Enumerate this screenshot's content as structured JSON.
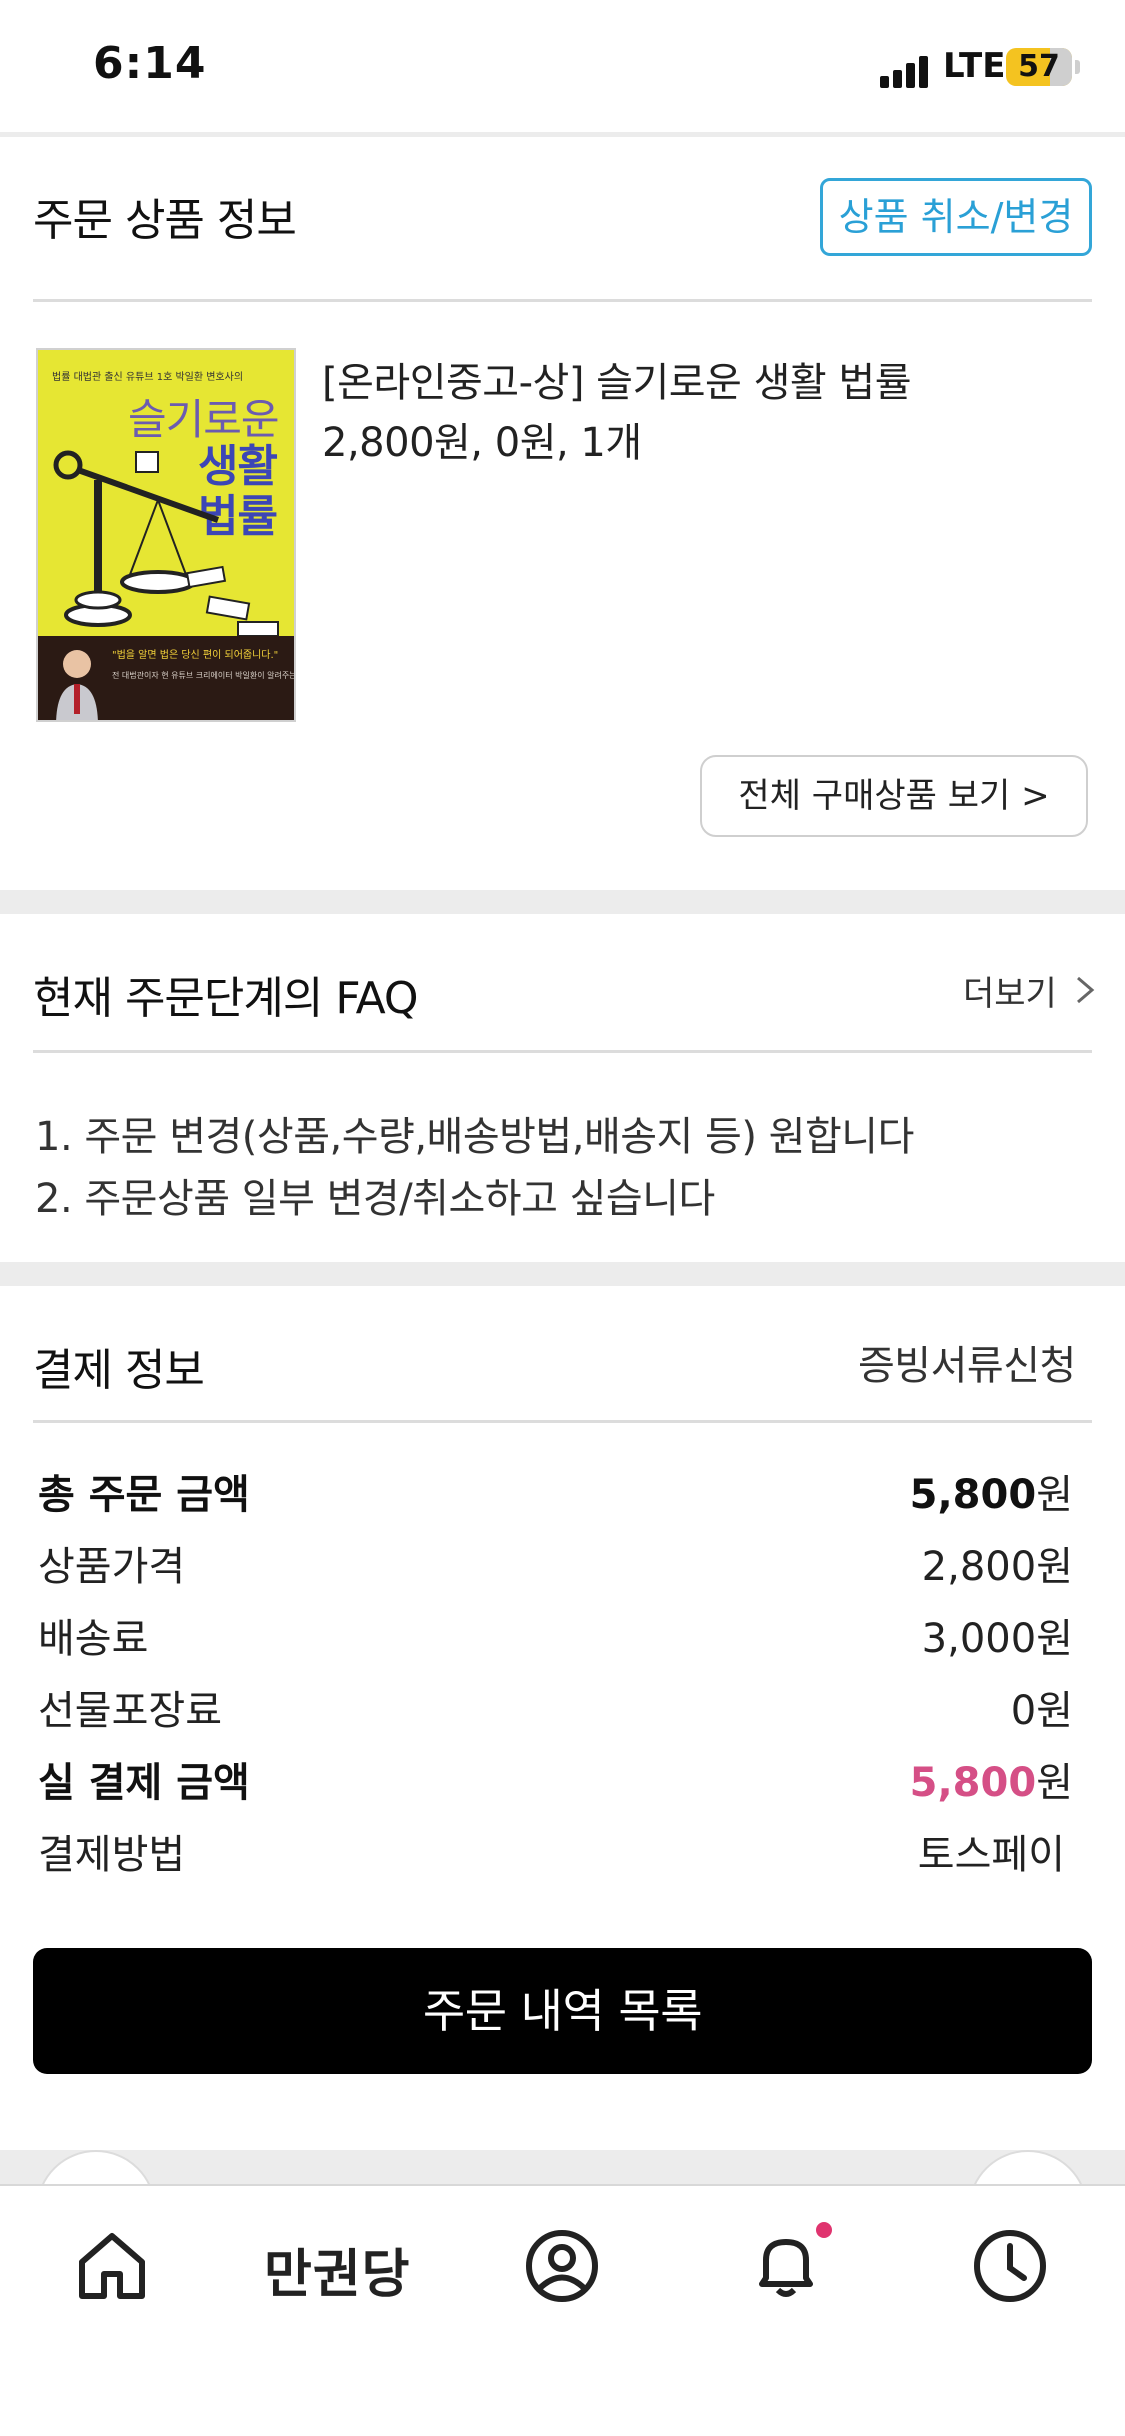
{
  "status_bar": {
    "time": "6:14",
    "network": "LTE",
    "battery": "57",
    "battery_color": "#f4c320"
  },
  "order_product": {
    "title": "주문 상품 정보",
    "cancel_button": "상품 취소/변경",
    "product": {
      "name": "[온라인중고-상] 슬기로운 생활 법률",
      "price_line": "2,800원, 0원, 1개",
      "cover": {
        "top_line": "법률 대법관 출신 유튜브 1호 박일환 변호사의",
        "title_line1": "슬기로운",
        "title_line2": "생활",
        "title_line3": "법률",
        "quote": "\"법을 알면 법은 당신 편이 되어줍니다.\"",
        "subtitle": "전 대법관이자 현 유튜브 크리에이터 박일환이 알려주는 생활 밀착형 법률 상식"
      }
    },
    "view_all_button": "전체 구매상품 보기 >"
  },
  "faq": {
    "title": "현재 주문단계의 FAQ",
    "more_label": "더보기",
    "items": [
      "1. 주문 변경(상품,수량,배송방법,배송지 등) 원합니다",
      "2. 주문상품 일부 변경/취소하고 싶습니다"
    ]
  },
  "payment": {
    "title": "결제 정보",
    "receipt_link": "증빙서류신청",
    "currency_suffix": "원",
    "rows": [
      {
        "label": "총 주문 금액",
        "value": "5,800"
      },
      {
        "label": "상품가격",
        "value": "2,800"
      },
      {
        "label": "배송료",
        "value": "3,000"
      },
      {
        "label": "선물포장료",
        "value": "0"
      },
      {
        "label": "실 결제 금액",
        "value": "5,800"
      }
    ],
    "method_label": "결제방법",
    "method_value": "토스페이",
    "highlight_color": "#d54f86"
  },
  "order_list_button": "주문 내역 목록",
  "bottom_nav": {
    "brand": "만권당",
    "items": [
      "home-icon",
      "brand-text",
      "profile-icon",
      "bell-icon",
      "clock-icon"
    ],
    "notification_dot_color": "#e0346f"
  }
}
